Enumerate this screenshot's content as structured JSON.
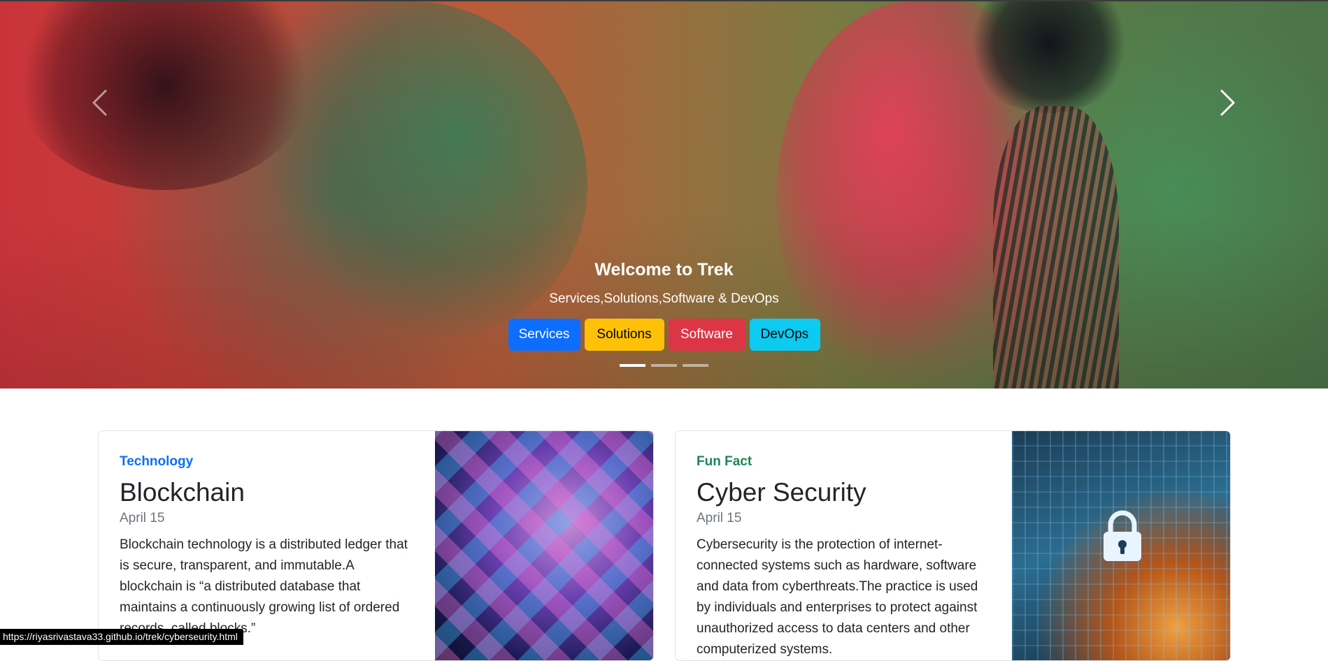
{
  "hero": {
    "title": "Welcome to Trek",
    "subtitle": "Services,Solutions,Software & DevOps",
    "buttons": [
      {
        "label": "Services"
      },
      {
        "label": "Solutions"
      },
      {
        "label": "Software"
      },
      {
        "label": "DevOps"
      }
    ],
    "slide_count": 3,
    "active_slide": 1
  },
  "cards": [
    {
      "category": "Technology",
      "title": "Blockchain",
      "date": "April 15",
      "text": "Blockchain technology is a distributed ledger that is secure, transparent, and immutable.A blockchain is “a distributed database that maintains a continuously growing list of ordered records, called blocks.”",
      "accent": "#0d6efd"
    },
    {
      "category": "Fun Fact",
      "title": "Cyber Security",
      "date": "April 15",
      "text": "Cybersecurity is the protection of internet-connected systems such as hardware, software and data from cyberthreats.The practice is used by individuals and enterprises to protect against unauthorized access to data centers and other computerized systems.",
      "accent": "#198754"
    }
  ],
  "status_bar": {
    "url": "https://riyasrivastava33.github.io/trek/cyberseurity.html"
  },
  "colors": {
    "primary": "#0d6efd",
    "warning": "#ffc107",
    "danger": "#dc3545",
    "info": "#0dcaf0"
  },
  "icons": {
    "prev": "chevron-left-icon",
    "next": "chevron-right-icon",
    "lock": "padlock-icon"
  }
}
